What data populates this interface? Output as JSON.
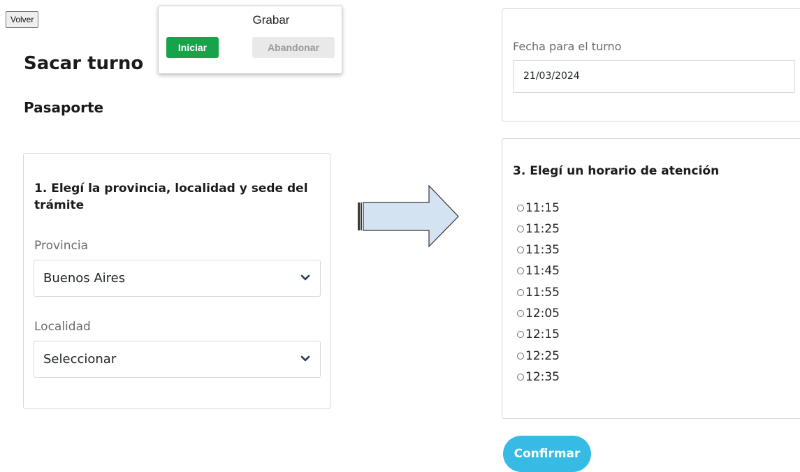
{
  "toolbar": {
    "back_label": "Volver"
  },
  "recorder": {
    "title": "Grabar",
    "start_label": "Iniciar",
    "abort_label": "Abandonar"
  },
  "page": {
    "title": "Sacar turno",
    "subtitle": "Pasaporte"
  },
  "location_step": {
    "heading": "1. Elegí la provincia, localidad y sede del trámite",
    "province": {
      "label": "Provincia",
      "value": "Buenos Aires"
    },
    "locality": {
      "label": "Localidad",
      "value": "Seleccionar"
    }
  },
  "date_step": {
    "label": "Fecha para el turno",
    "value": "21/03/2024"
  },
  "time_step": {
    "heading": "3. Elegí un horario de atención",
    "options": [
      "11:15",
      "11:25",
      "11:35",
      "11:45",
      "11:55",
      "12:05",
      "12:15",
      "12:25",
      "12:35"
    ]
  },
  "confirm_label": "Confirmar",
  "colors": {
    "recorder_start": "#16a34a",
    "confirm": "#37bbe4",
    "arrow_fill": "#d4e3f2"
  },
  "icons": {
    "select": "chevron-down-icon",
    "flow": "right-arrow-icon"
  }
}
